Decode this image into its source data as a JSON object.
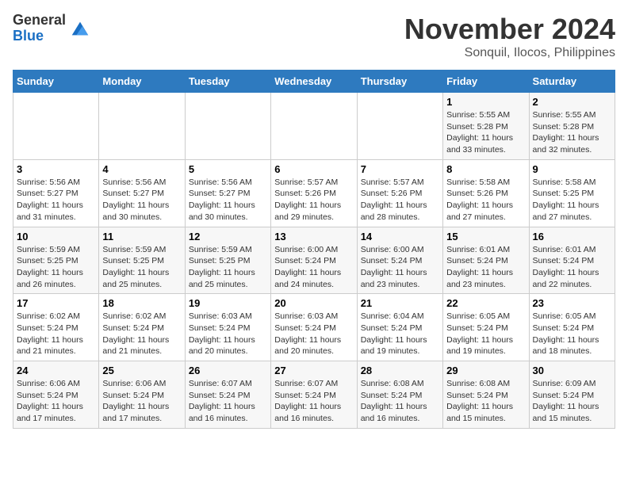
{
  "header": {
    "logo_line1": "General",
    "logo_line2": "Blue",
    "month": "November 2024",
    "location": "Sonquil, Ilocos, Philippines"
  },
  "weekdays": [
    "Sunday",
    "Monday",
    "Tuesday",
    "Wednesday",
    "Thursday",
    "Friday",
    "Saturday"
  ],
  "weeks": [
    [
      {
        "day": "",
        "info": ""
      },
      {
        "day": "",
        "info": ""
      },
      {
        "day": "",
        "info": ""
      },
      {
        "day": "",
        "info": ""
      },
      {
        "day": "",
        "info": ""
      },
      {
        "day": "1",
        "info": "Sunrise: 5:55 AM\nSunset: 5:28 PM\nDaylight: 11 hours and 33 minutes."
      },
      {
        "day": "2",
        "info": "Sunrise: 5:55 AM\nSunset: 5:28 PM\nDaylight: 11 hours and 32 minutes."
      }
    ],
    [
      {
        "day": "3",
        "info": "Sunrise: 5:56 AM\nSunset: 5:27 PM\nDaylight: 11 hours and 31 minutes."
      },
      {
        "day": "4",
        "info": "Sunrise: 5:56 AM\nSunset: 5:27 PM\nDaylight: 11 hours and 30 minutes."
      },
      {
        "day": "5",
        "info": "Sunrise: 5:56 AM\nSunset: 5:27 PM\nDaylight: 11 hours and 30 minutes."
      },
      {
        "day": "6",
        "info": "Sunrise: 5:57 AM\nSunset: 5:26 PM\nDaylight: 11 hours and 29 minutes."
      },
      {
        "day": "7",
        "info": "Sunrise: 5:57 AM\nSunset: 5:26 PM\nDaylight: 11 hours and 28 minutes."
      },
      {
        "day": "8",
        "info": "Sunrise: 5:58 AM\nSunset: 5:26 PM\nDaylight: 11 hours and 27 minutes."
      },
      {
        "day": "9",
        "info": "Sunrise: 5:58 AM\nSunset: 5:25 PM\nDaylight: 11 hours and 27 minutes."
      }
    ],
    [
      {
        "day": "10",
        "info": "Sunrise: 5:59 AM\nSunset: 5:25 PM\nDaylight: 11 hours and 26 minutes."
      },
      {
        "day": "11",
        "info": "Sunrise: 5:59 AM\nSunset: 5:25 PM\nDaylight: 11 hours and 25 minutes."
      },
      {
        "day": "12",
        "info": "Sunrise: 5:59 AM\nSunset: 5:25 PM\nDaylight: 11 hours and 25 minutes."
      },
      {
        "day": "13",
        "info": "Sunrise: 6:00 AM\nSunset: 5:24 PM\nDaylight: 11 hours and 24 minutes."
      },
      {
        "day": "14",
        "info": "Sunrise: 6:00 AM\nSunset: 5:24 PM\nDaylight: 11 hours and 23 minutes."
      },
      {
        "day": "15",
        "info": "Sunrise: 6:01 AM\nSunset: 5:24 PM\nDaylight: 11 hours and 23 minutes."
      },
      {
        "day": "16",
        "info": "Sunrise: 6:01 AM\nSunset: 5:24 PM\nDaylight: 11 hours and 22 minutes."
      }
    ],
    [
      {
        "day": "17",
        "info": "Sunrise: 6:02 AM\nSunset: 5:24 PM\nDaylight: 11 hours and 21 minutes."
      },
      {
        "day": "18",
        "info": "Sunrise: 6:02 AM\nSunset: 5:24 PM\nDaylight: 11 hours and 21 minutes."
      },
      {
        "day": "19",
        "info": "Sunrise: 6:03 AM\nSunset: 5:24 PM\nDaylight: 11 hours and 20 minutes."
      },
      {
        "day": "20",
        "info": "Sunrise: 6:03 AM\nSunset: 5:24 PM\nDaylight: 11 hours and 20 minutes."
      },
      {
        "day": "21",
        "info": "Sunrise: 6:04 AM\nSunset: 5:24 PM\nDaylight: 11 hours and 19 minutes."
      },
      {
        "day": "22",
        "info": "Sunrise: 6:05 AM\nSunset: 5:24 PM\nDaylight: 11 hours and 19 minutes."
      },
      {
        "day": "23",
        "info": "Sunrise: 6:05 AM\nSunset: 5:24 PM\nDaylight: 11 hours and 18 minutes."
      }
    ],
    [
      {
        "day": "24",
        "info": "Sunrise: 6:06 AM\nSunset: 5:24 PM\nDaylight: 11 hours and 17 minutes."
      },
      {
        "day": "25",
        "info": "Sunrise: 6:06 AM\nSunset: 5:24 PM\nDaylight: 11 hours and 17 minutes."
      },
      {
        "day": "26",
        "info": "Sunrise: 6:07 AM\nSunset: 5:24 PM\nDaylight: 11 hours and 16 minutes."
      },
      {
        "day": "27",
        "info": "Sunrise: 6:07 AM\nSunset: 5:24 PM\nDaylight: 11 hours and 16 minutes."
      },
      {
        "day": "28",
        "info": "Sunrise: 6:08 AM\nSunset: 5:24 PM\nDaylight: 11 hours and 16 minutes."
      },
      {
        "day": "29",
        "info": "Sunrise: 6:08 AM\nSunset: 5:24 PM\nDaylight: 11 hours and 15 minutes."
      },
      {
        "day": "30",
        "info": "Sunrise: 6:09 AM\nSunset: 5:24 PM\nDaylight: 11 hours and 15 minutes."
      }
    ]
  ]
}
